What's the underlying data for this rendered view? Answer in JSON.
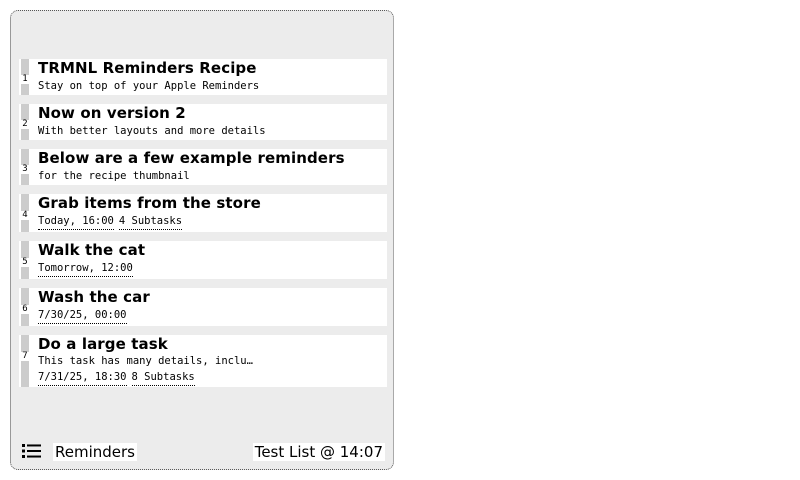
{
  "app": {
    "name": "Reminders",
    "list_info": "Test List @ 14:07"
  },
  "reminders": [
    {
      "index": "1",
      "title": "TRMNL Reminders Recipe",
      "notes": "Stay on top of your Apple Reminders",
      "tags": []
    },
    {
      "index": "2",
      "title": "Now on version 2",
      "notes": "With better layouts and more details",
      "tags": []
    },
    {
      "index": "3",
      "title": "Below are a few example reminders",
      "notes": "for the recipe thumbnail",
      "tags": []
    },
    {
      "index": "4",
      "title": "Grab items from the store",
      "notes": "",
      "tags": [
        "Today, 16:00",
        "4 Subtasks"
      ]
    },
    {
      "index": "5",
      "title": "Walk the cat",
      "notes": "",
      "tags": [
        "Tomorrow, 12:00"
      ]
    },
    {
      "index": "6",
      "title": "Wash the car",
      "notes": "",
      "tags": [
        "7/30/25, 00:00"
      ]
    },
    {
      "index": "7",
      "title": "Do a large task",
      "notes": "This task has many details, inclu…",
      "tags": [
        "7/31/25, 18:30",
        "8 Subtasks"
      ]
    }
  ],
  "icons": {
    "footer": "list-icon"
  }
}
